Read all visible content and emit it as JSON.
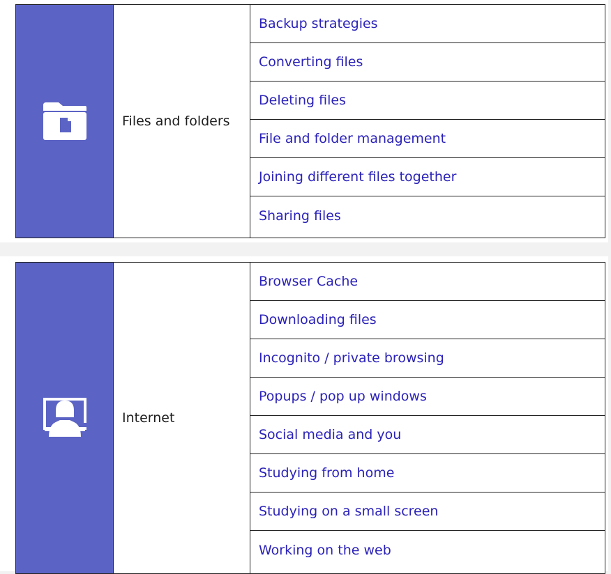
{
  "colors": {
    "icon_background": "#5b63c4",
    "link": "#2b22b8",
    "border": "#222222"
  },
  "sections": [
    {
      "name": "Files and folders",
      "icon": "folder-file-icon",
      "links": [
        "Backup strategies",
        "Converting files",
        "Deleting files",
        "File and folder management",
        "Joining different files together",
        "Sharing files"
      ]
    },
    {
      "name": "Internet",
      "icon": "person-monitor-icon",
      "links": [
        "Browser Cache",
        "Downloading files",
        "Incognito / private browsing",
        "Popups / pop up windows",
        "Social media and you",
        "Studying from home",
        "Studying on a small screen",
        "Working on the web"
      ]
    }
  ]
}
